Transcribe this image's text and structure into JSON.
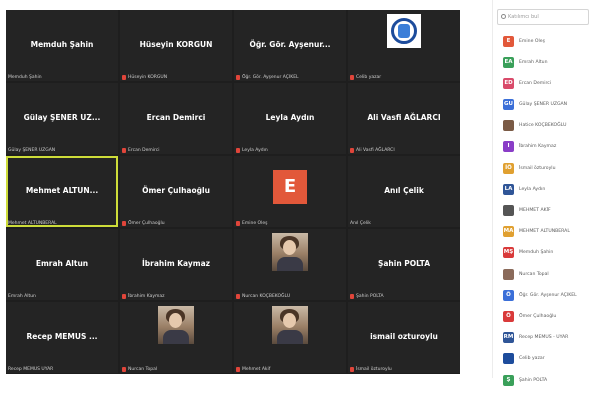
{
  "grid": {
    "tiles": [
      {
        "name": "Memduh Şahin",
        "caption": "Memduh Şahin",
        "muted": false,
        "kind": "name"
      },
      {
        "name": "Hüseyin KORGUN",
        "caption": "Hüseyin KORGUN",
        "muted": true,
        "kind": "name"
      },
      {
        "name": "Öğr. Gör. Ayşenur...",
        "caption": "Öğr. Gör. Ayşenur AÇIKEL",
        "muted": true,
        "kind": "name"
      },
      {
        "name": "",
        "caption": "Celib yazar",
        "muted": true,
        "kind": "logo"
      },
      {
        "name": "Gülay ŞENER UZ...",
        "caption": "Gülay ŞENER UZGAN",
        "muted": false,
        "kind": "name"
      },
      {
        "name": "Ercan Demirci",
        "caption": "Ercan Demirci",
        "muted": true,
        "kind": "name"
      },
      {
        "name": "Leyla Aydın",
        "caption": "Leyla Aydın",
        "muted": true,
        "kind": "name"
      },
      {
        "name": "Ali Vasfi AĞLARCI",
        "caption": "Ali Vasfi AĞLARCI",
        "muted": true,
        "kind": "name"
      },
      {
        "name": "Mehmet ALTUN...",
        "caption": "Mehmet ALTUNBERAL",
        "muted": false,
        "kind": "name",
        "active": true
      },
      {
        "name": "Ömer Çulhaoğlu",
        "caption": "Ömer Çulhaoğlu",
        "muted": true,
        "kind": "name"
      },
      {
        "name": "",
        "caption": "Emine Oleş",
        "muted": true,
        "kind": "avatar",
        "letter": "E"
      },
      {
        "name": "Anıl Çelik",
        "caption": "Anıl Çelik",
        "muted": false,
        "kind": "name"
      },
      {
        "name": "Emrah Altun",
        "caption": "Emrah Altun",
        "muted": false,
        "kind": "name"
      },
      {
        "name": "İbrahim Kaymaz",
        "caption": "İbrahim Kaymaz",
        "muted": true,
        "kind": "name"
      },
      {
        "name": "",
        "caption": "Nurcan KOÇBEKOĞLU",
        "muted": true,
        "kind": "photo"
      },
      {
        "name": "Şahin POLTA",
        "caption": "Şahin POLTA",
        "muted": true,
        "kind": "name"
      },
      {
        "name": "Recep MEMUS ...",
        "caption": "Recep MEMUS UYAR",
        "muted": false,
        "kind": "name"
      },
      {
        "name": "",
        "caption": "Nurcan Topal",
        "muted": true,
        "kind": "photo"
      },
      {
        "name": "",
        "caption": "Mehmet Akif",
        "muted": true,
        "kind": "photo"
      },
      {
        "name": "ismail ozturoylu",
        "caption": "İsmail özturoylu",
        "muted": true,
        "kind": "name"
      }
    ]
  },
  "panel": {
    "search_placeholder": "Katılımcı bul",
    "participants": [
      {
        "initials": "E",
        "name": "Emine Oleş",
        "color": "#e2583a"
      },
      {
        "initials": "EA",
        "name": "Emrah Altun",
        "color": "#3aa05a"
      },
      {
        "initials": "ED",
        "name": "Ercan Demirci",
        "color": "#d94a6a"
      },
      {
        "initials": "GU",
        "name": "Gülay ŞENER UZGAN",
        "color": "#3b6fd8"
      },
      {
        "initials": "",
        "name": "Hatice KOÇBEKOĞLU",
        "color": "#7a5a45"
      },
      {
        "initials": "I",
        "name": "İbrahim Kaymaz",
        "color": "#8a3dc7"
      },
      {
        "initials": "İÖ",
        "name": "İsmail özturoylu",
        "color": "#e0a030"
      },
      {
        "initials": "LA",
        "name": "Leyla Aydın",
        "color": "#2f5597"
      },
      {
        "initials": "",
        "name": "MEHMET AKİF",
        "color": "#555555"
      },
      {
        "initials": "MA",
        "name": "MEHMET ALTUNBERAL",
        "color": "#e0a030"
      },
      {
        "initials": "MŞ",
        "name": "Memduh Şahin",
        "color": "#d93a3a"
      },
      {
        "initials": "",
        "name": "Nurcan Topal",
        "color": "#8a6a5a"
      },
      {
        "initials": "Ö",
        "name": "Öğr. Gör. Ayşenur AÇIKEL",
        "color": "#3b6fd8"
      },
      {
        "initials": "Ö",
        "name": "Ömer Çulhaoğlu",
        "color": "#d93a3a"
      },
      {
        "initials": "RM",
        "name": "Recep MEMUS - UYAR",
        "color": "#2f5597"
      },
      {
        "initials": "",
        "name": "Celib yazar",
        "color": "#1d4c9c"
      },
      {
        "initials": "Ş",
        "name": "Şahin POLTA",
        "color": "#3aa05a"
      }
    ]
  }
}
